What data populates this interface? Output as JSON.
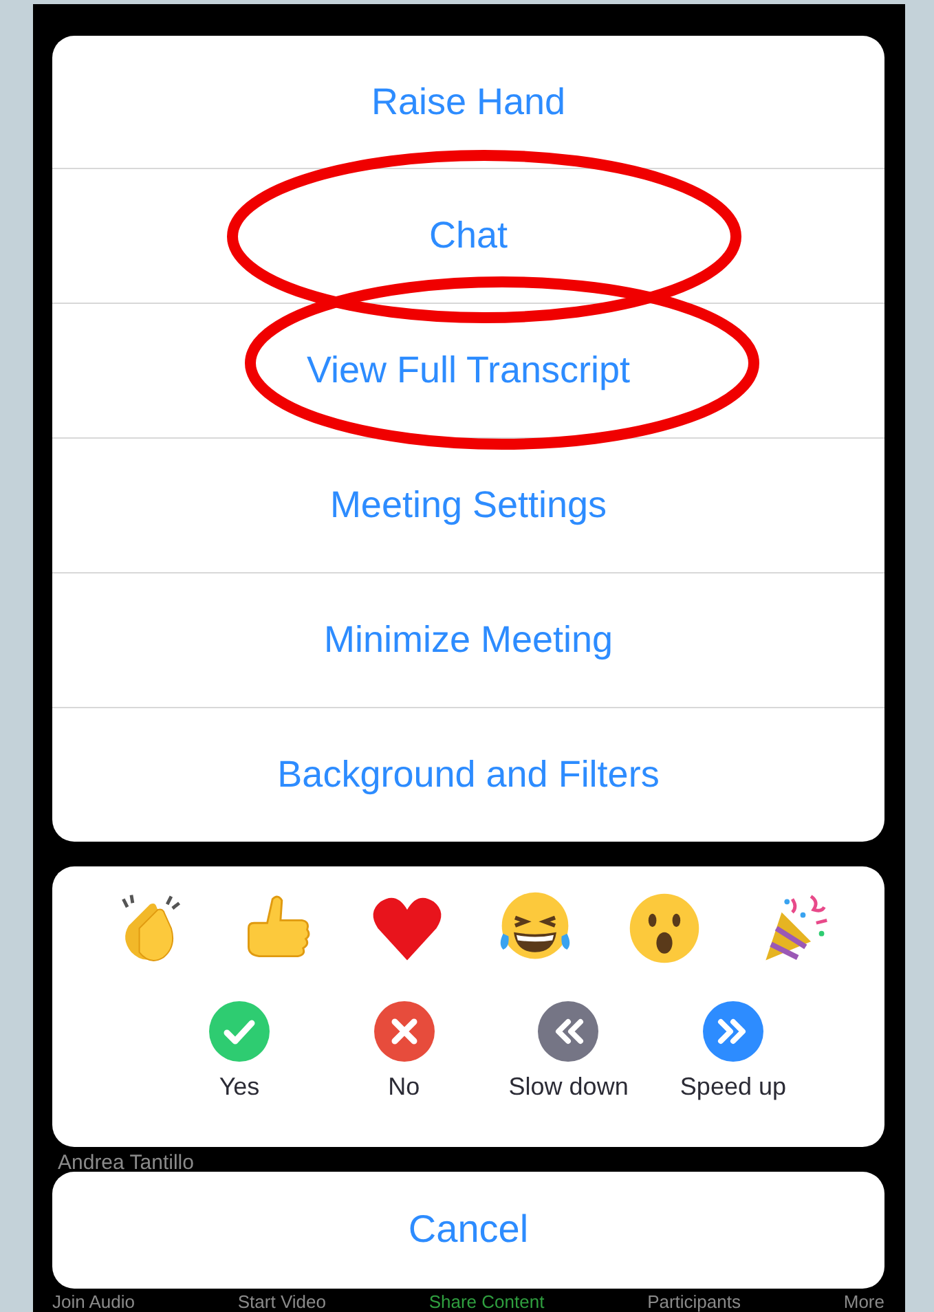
{
  "menu": [
    {
      "label": "Raise Hand",
      "circled": false
    },
    {
      "label": "Chat",
      "circled": true
    },
    {
      "label": "View Full Transcript",
      "circled": true
    },
    {
      "label": "Meeting Settings",
      "circled": false
    },
    {
      "label": "Minimize Meeting",
      "circled": false
    },
    {
      "label": "Background and Filters",
      "circled": false
    }
  ],
  "reactions": [
    {
      "kind": "clap"
    },
    {
      "kind": "thumbs"
    },
    {
      "kind": "heart"
    },
    {
      "kind": "laugh"
    },
    {
      "kind": "wow"
    },
    {
      "kind": "party"
    }
  ],
  "feedback": [
    {
      "kind": "yes",
      "label": "Yes"
    },
    {
      "kind": "no",
      "label": "No"
    },
    {
      "kind": "slow",
      "label": "Slow down"
    },
    {
      "kind": "fast",
      "label": "Speed up"
    }
  ],
  "participant_name": "Andrea Tantillo",
  "cancel": "Cancel",
  "toolbar": [
    {
      "label": "Join Audio",
      "color": "#8a8a8a"
    },
    {
      "label": "Start Video",
      "color": "#8a8a8a"
    },
    {
      "label": "Share Content",
      "color": "#2f9e3f"
    },
    {
      "label": "Participants",
      "color": "#8a8a8a"
    },
    {
      "label": "More",
      "color": "#8a8a8a"
    }
  ]
}
